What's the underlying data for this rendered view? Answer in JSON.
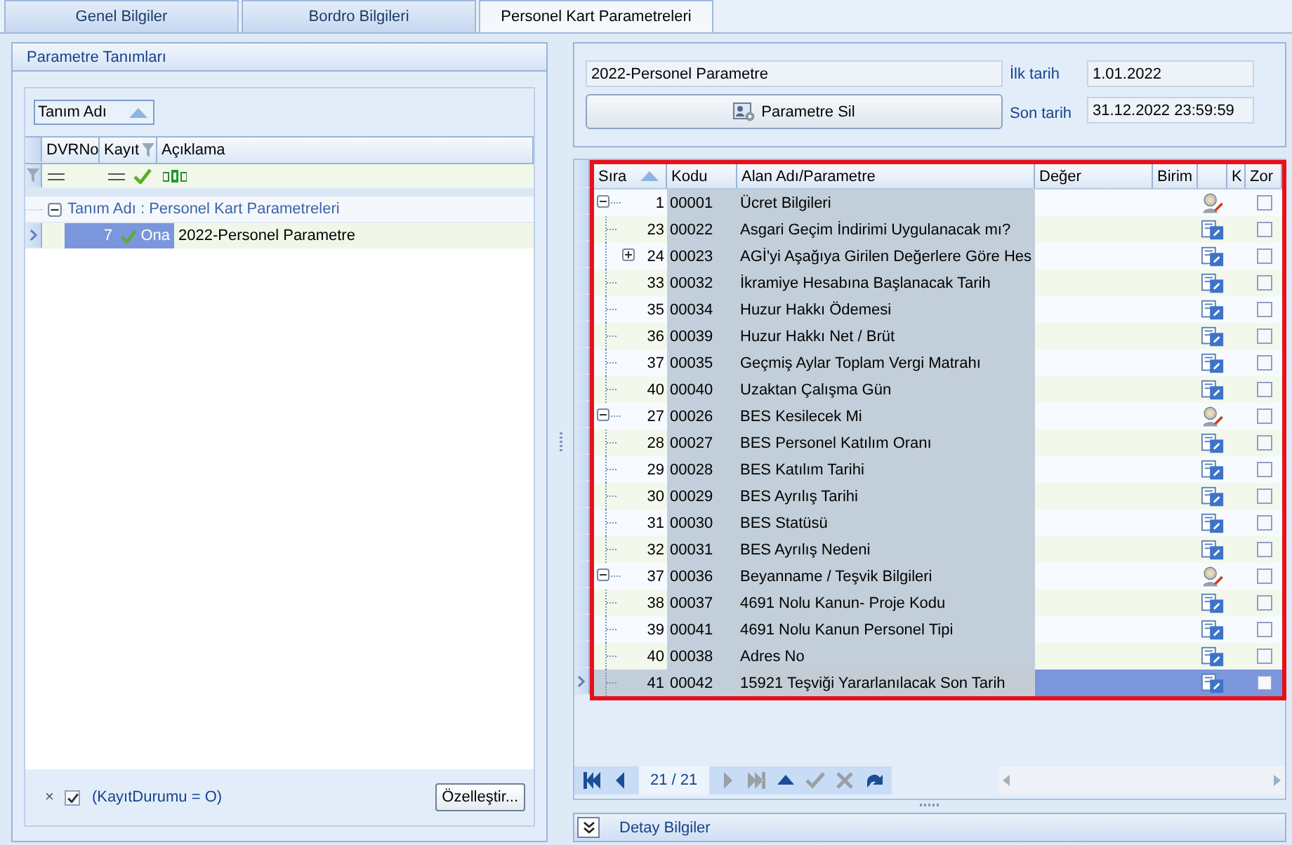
{
  "tabs": [
    {
      "label": "Genel Bilgiler",
      "selected": false
    },
    {
      "label": "Bordro Bilgileri",
      "selected": false
    },
    {
      "label": "Personel Kart Parametreleri",
      "selected": true
    }
  ],
  "left_panel": {
    "title": "Parametre Tanımları",
    "group_by": "Tanım Adı",
    "columns": [
      "DVRNo",
      "Kayıt",
      "Açıklama"
    ],
    "group": {
      "label": "Tanım Adı : Personel Kart Parametreleri",
      "expanded": true
    },
    "rows": [
      {
        "dvrno": "7",
        "status": "Ona",
        "approved": true,
        "description": "2022-Personel Parametre",
        "selected": true
      }
    ],
    "filter": {
      "clear_symbol": "×",
      "enabled": true,
      "text": "(KayıtDurumu = O)"
    },
    "customize_button": "Özelleştir..."
  },
  "header": {
    "name": "2022-Personel Parametre",
    "delete_button": "Parametre Sil",
    "start_label": "İlk tarih",
    "start": "1.01.2022",
    "end_label": "Son tarih",
    "end": "31.12.2022 23:59:59"
  },
  "grid": {
    "columns": [
      "Sıra",
      "Kodu",
      "Alan Adı/Parametre",
      "Değer",
      "Birim",
      "K",
      "Zor"
    ],
    "rows": [
      {
        "sira": "1",
        "kodu": "00001",
        "name": "Ücret Bilgileri",
        "expanded": true,
        "checked": false,
        "selected": false,
        "children": [
          {
            "sira": "23",
            "kodu": "00022",
            "name": "Asgari Geçim İndirimi Uygulanacak mı?",
            "checked": false,
            "selected": false
          },
          {
            "sira": "24",
            "kodu": "00023",
            "name": "AGİ'yi Aşağıya Girilen Değerlere Göre Hes",
            "expanded": false,
            "checked": false,
            "selected": false
          },
          {
            "sira": "33",
            "kodu": "00032",
            "name": "İkramiye Hesabına Başlanacak Tarih",
            "checked": false,
            "selected": false
          },
          {
            "sira": "35",
            "kodu": "00034",
            "name": "Huzur Hakkı Ödemesi",
            "checked": false,
            "selected": false
          },
          {
            "sira": "36",
            "kodu": "00039",
            "name": "Huzur Hakkı Net / Brüt",
            "checked": false,
            "selected": false
          },
          {
            "sira": "37",
            "kodu": "00035",
            "name": "Geçmiş Aylar Toplam Vergi Matrahı",
            "checked": false,
            "selected": false
          },
          {
            "sira": "40",
            "kodu": "00040",
            "name": "Uzaktan Çalışma Gün",
            "checked": false,
            "selected": false
          }
        ]
      },
      {
        "sira": "27",
        "kodu": "00026",
        "name": "BES Kesilecek Mi",
        "expanded": true,
        "checked": false,
        "selected": false,
        "children": [
          {
            "sira": "28",
            "kodu": "00027",
            "name": "BES Personel Katılım Oranı",
            "checked": false,
            "selected": false
          },
          {
            "sira": "29",
            "kodu": "00028",
            "name": "BES Katılım Tarihi",
            "checked": false,
            "selected": false
          },
          {
            "sira": "30",
            "kodu": "00029",
            "name": "BES Ayrılış Tarihi",
            "checked": false,
            "selected": false
          },
          {
            "sira": "31",
            "kodu": "00030",
            "name": "BES Statüsü",
            "checked": false,
            "selected": false
          },
          {
            "sira": "32",
            "kodu": "00031",
            "name": "BES Ayrılış Nedeni",
            "checked": false,
            "selected": false
          }
        ]
      },
      {
        "sira": "37",
        "kodu": "00036",
        "name": "Beyanname / Teşvik Bilgileri",
        "expanded": true,
        "checked": false,
        "selected": false,
        "children": [
          {
            "sira": "38",
            "kodu": "00037",
            "name": "4691 Nolu Kanun- Proje Kodu",
            "checked": false,
            "selected": false
          },
          {
            "sira": "39",
            "kodu": "00041",
            "name": "4691 Nolu Kanun Personel Tipi",
            "checked": false,
            "selected": false
          },
          {
            "sira": "40",
            "kodu": "00038",
            "name": "Adres No",
            "checked": false,
            "selected": false
          },
          {
            "sira": "41",
            "kodu": "00042",
            "name": "15921 Teşviği Yararlanılacak Son Tarih",
            "checked": false,
            "selected": true
          }
        ]
      }
    ]
  },
  "navigator": {
    "position": "21 / 21",
    "buttons": [
      {
        "kind": "first",
        "disabled": false
      },
      {
        "kind": "prev",
        "disabled": false
      },
      {
        "kind": "next",
        "disabled": true
      },
      {
        "kind": "last",
        "disabled": true
      },
      {
        "kind": "insert",
        "disabled": false
      },
      {
        "kind": "save",
        "disabled": true
      },
      {
        "kind": "cancel",
        "disabled": true
      },
      {
        "kind": "refresh",
        "disabled": false
      }
    ]
  },
  "detail_bar": {
    "label": "Detay Bilgiler",
    "expanded": false
  }
}
